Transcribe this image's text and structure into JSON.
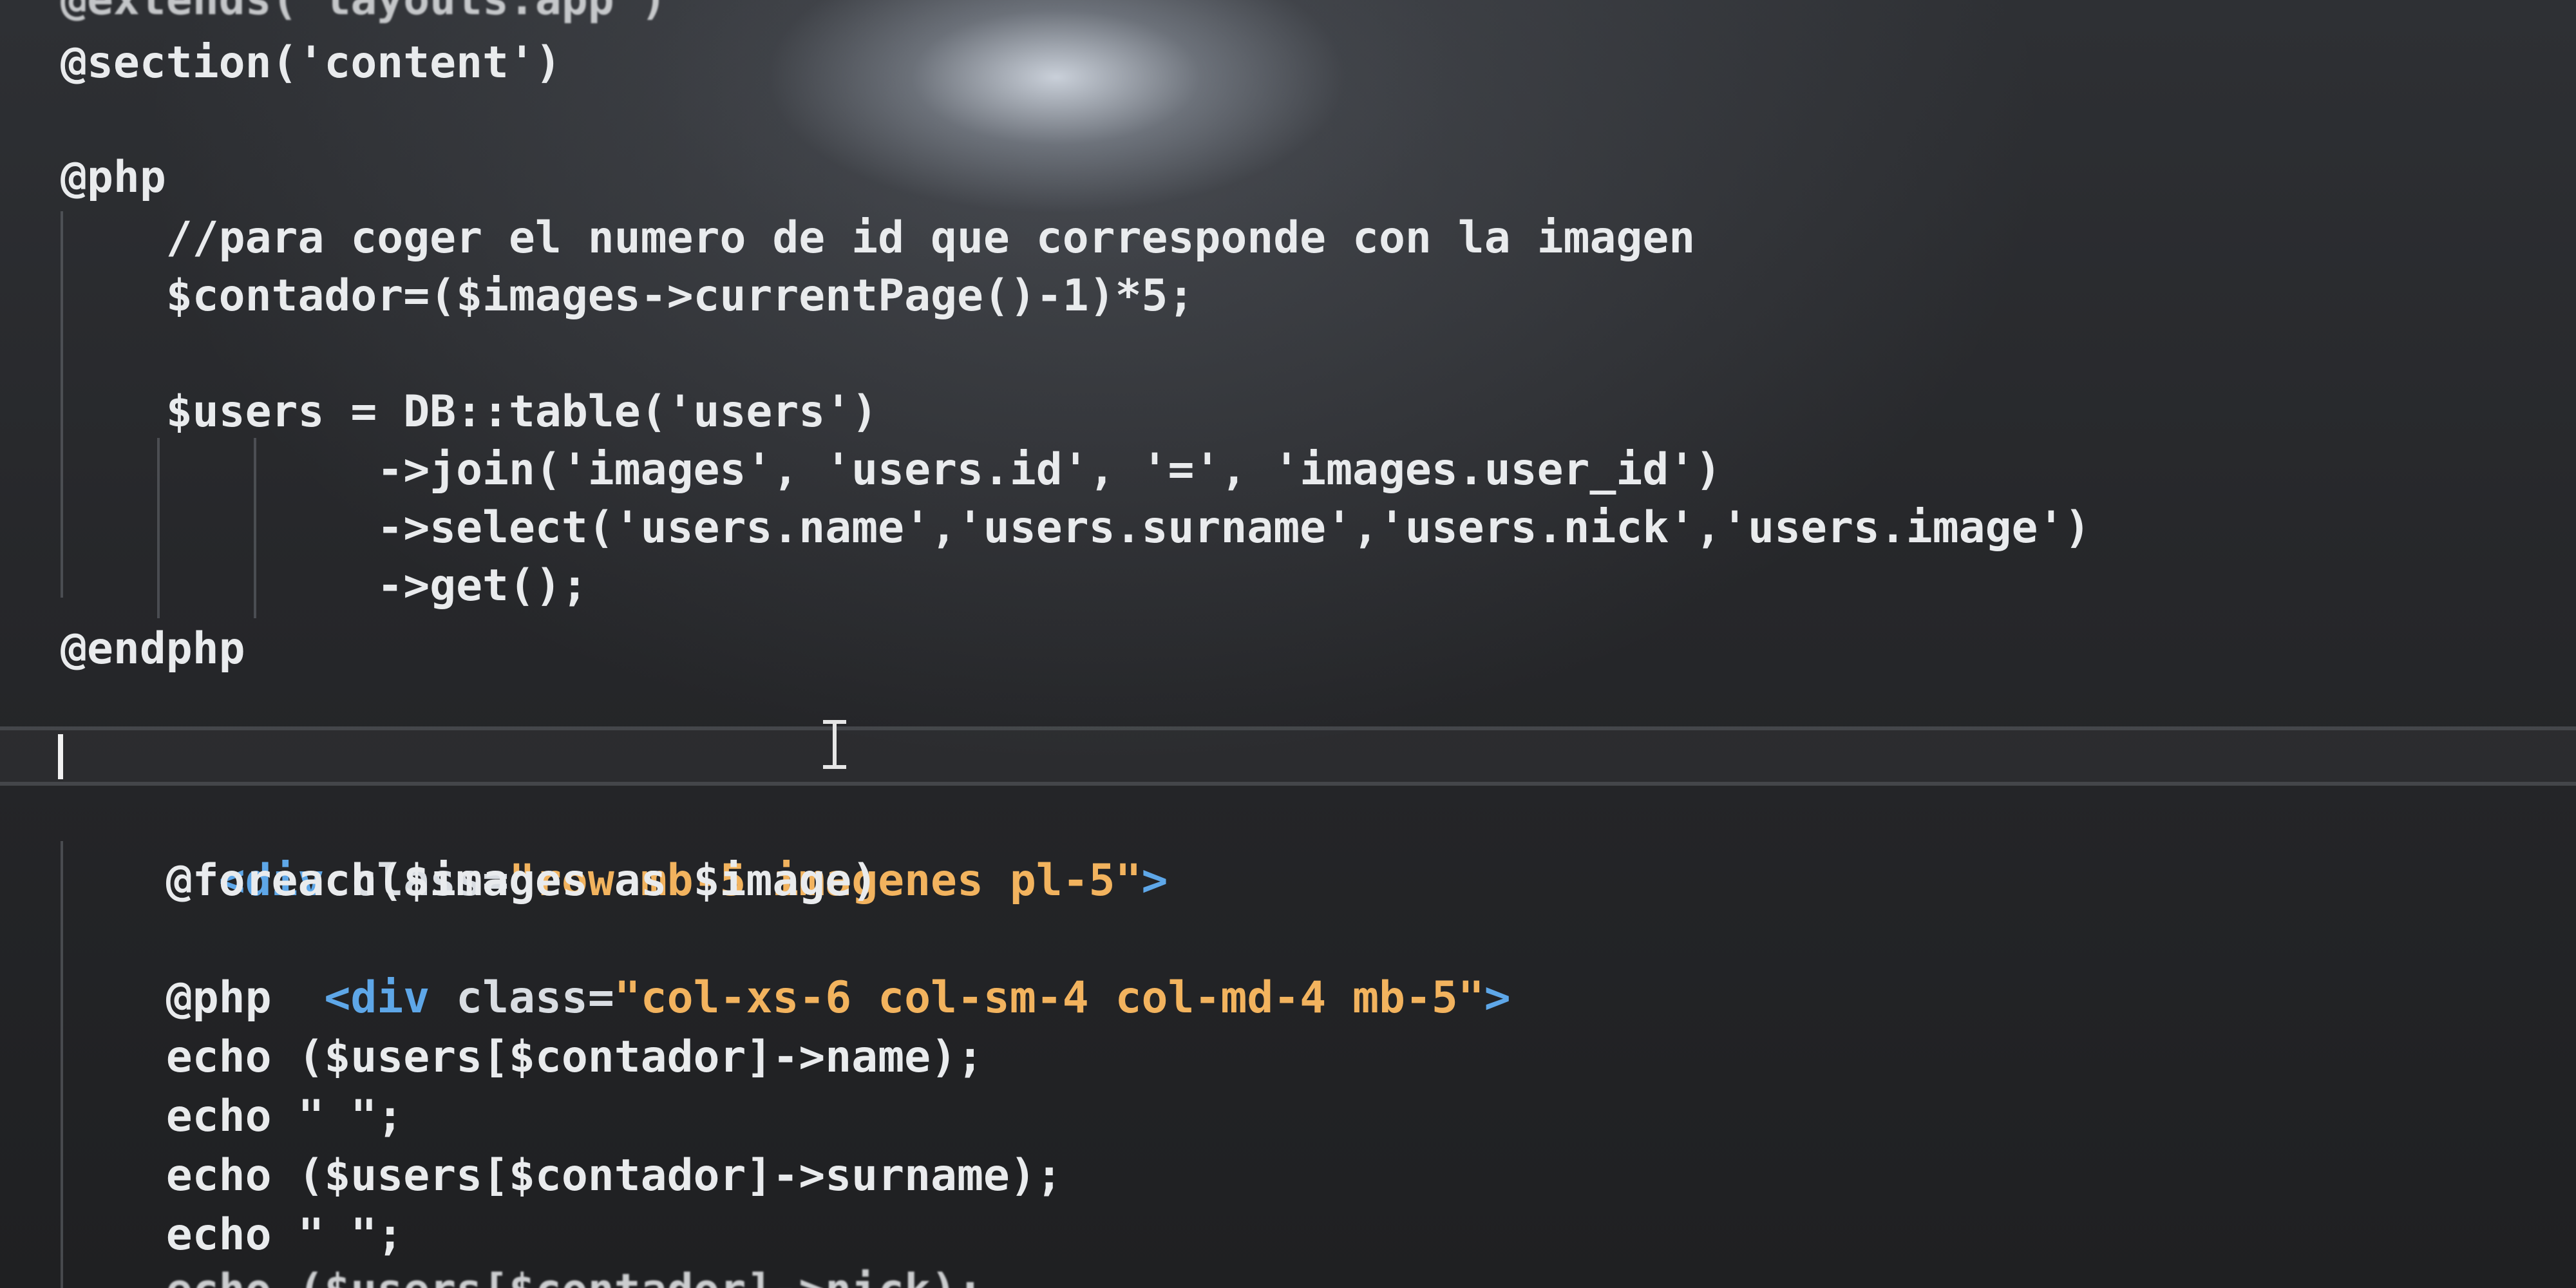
{
  "editor": {
    "lines": [
      "@extends('layouts.app')",
      "@section('content')",
      "",
      "@php",
      "    //para coger el numero de id que corresponde con la imagen",
      "    $contador=($images->currentPage()-1)*5;",
      "",
      "    $users = DB::table('users')",
      "            ->join('images', 'users.id', '=', 'images.user_id')",
      "            ->select('users.name','users.surname','users.nick','users.image')",
      "            ->get();",
      "@endphp",
      "",
      "",
      "<div class=\"row mb-5 imagenes pl-5\">",
      "    @foreach($images as $image)",
      "    <div class=\"col-xs-6 col-sm-4 col-md-4 mb-5\">",
      "    @php",
      "    echo ($users[$contador]->name);",
      "    echo \" \";",
      "    echo ($users[$contador]->surname);",
      "    echo \" \";",
      "    echo ($users[$contador]->nick);"
    ],
    "html_line_1": {
      "open": "<",
      "tag": "div",
      "attr": " class=",
      "value": "\"row mb-5 imagenes pl-5\"",
      "close": ">"
    },
    "html_line_2": {
      "indent": "    ",
      "open": "<",
      "tag": "div",
      "attr": " class=",
      "value": "\"col-xs-6 col-sm-4 col-md-4 mb-5\"",
      "close": ">"
    }
  },
  "colors": {
    "background": "#232426",
    "text": "#e9ebed",
    "tag": "#5ea7e8",
    "string": "#f2b35e"
  }
}
